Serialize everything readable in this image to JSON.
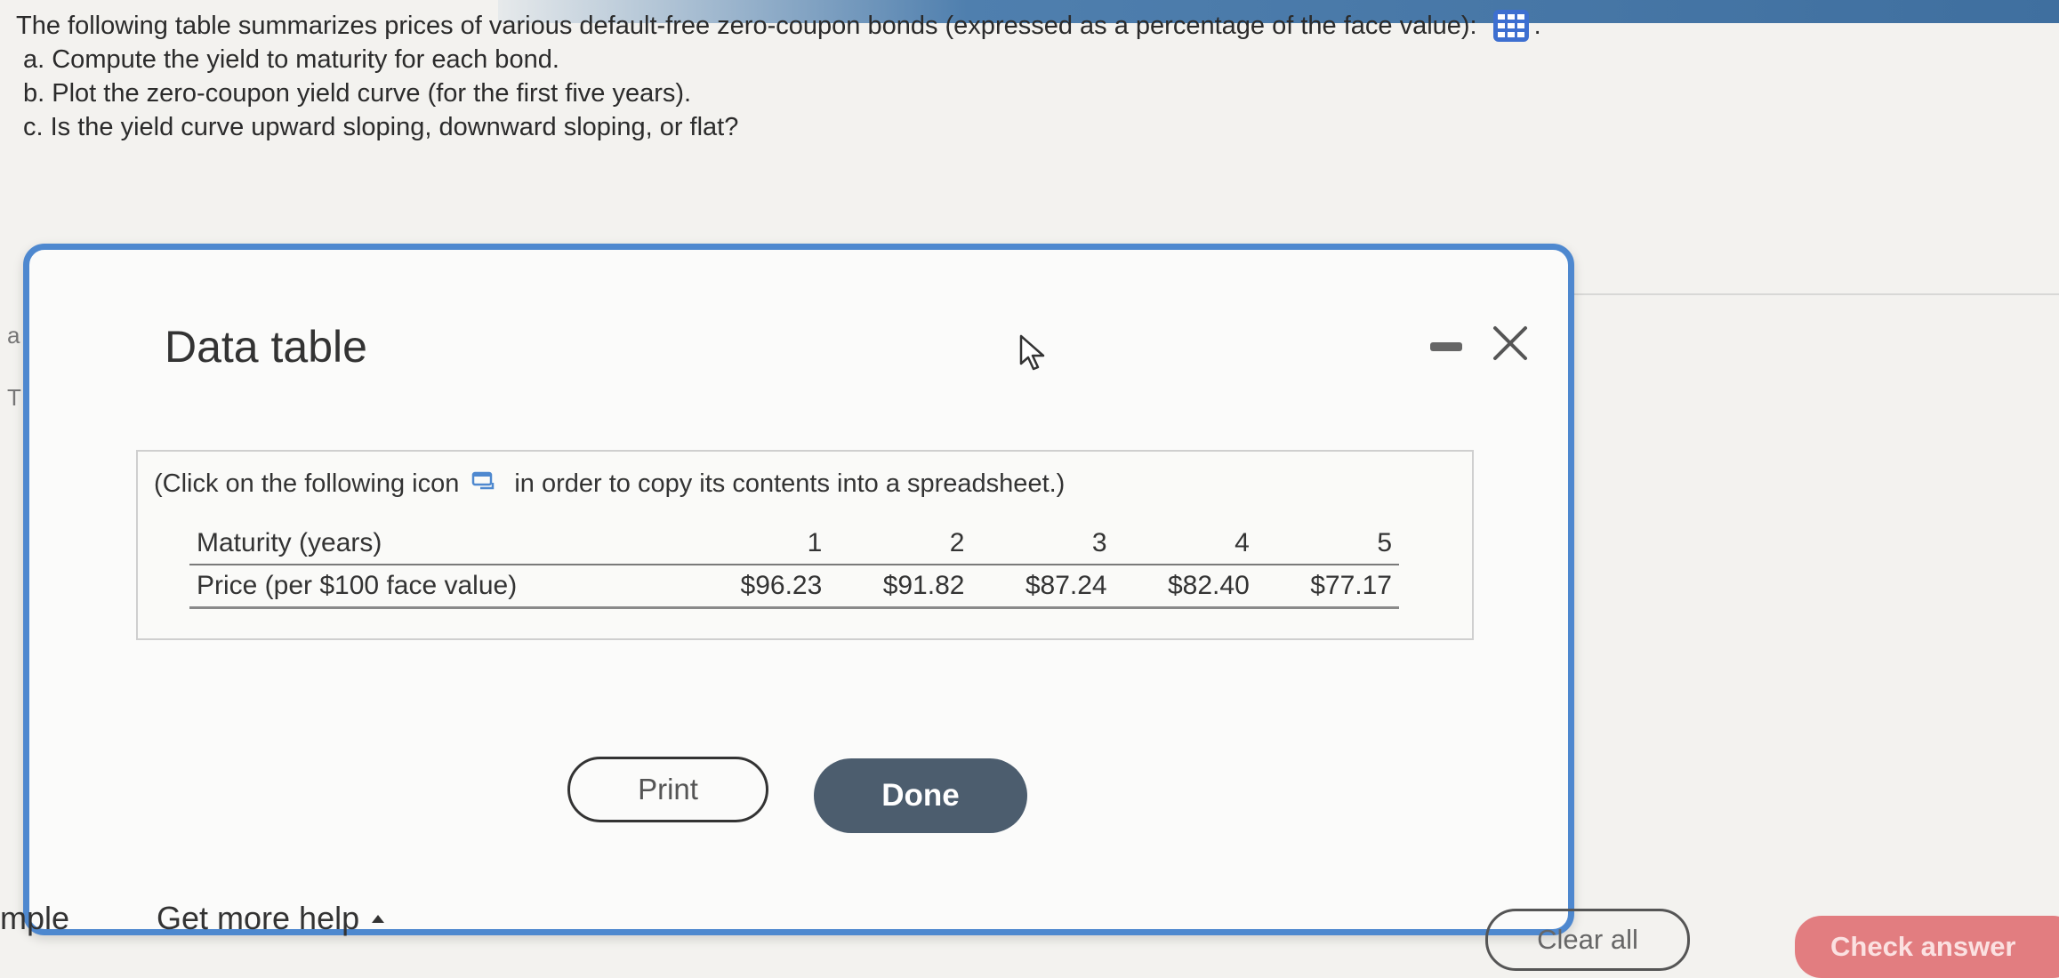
{
  "question": {
    "intro": "The following table summarizes prices of various default-free zero-coupon bonds (expressed as a percentage of the face value):",
    "part_a": "a. Compute the yield to maturity for each bond.",
    "part_b": "b. Plot the zero-coupon yield curve (for the first five years).",
    "part_c": "c. Is the yield curve upward sloping, downward sloping, or flat?"
  },
  "edge_letters": [
    "a",
    "T"
  ],
  "modal": {
    "title": "Data table",
    "instruction_before": "(Click on the following icon",
    "instruction_after": "in order to copy its contents into a spreadsheet.)",
    "table": {
      "header_label": "Maturity (years)",
      "maturities": [
        "1",
        "2",
        "3",
        "4",
        "5"
      ],
      "row_label": "Price (per $100 face value)",
      "prices": [
        "$96.23",
        "$91.82",
        "$87.24",
        "$82.40",
        "$77.17"
      ]
    },
    "print_label": "Print",
    "done_label": "Done"
  },
  "footer": {
    "example_label": "mple",
    "help_label": "Get more help",
    "clear_all_label": "Clear all",
    "check_answer_label": "Check answer"
  },
  "colors": {
    "modal_border": "#4e88cf",
    "done_button": "#4c5d6e",
    "check_answer_button": "#e27d80",
    "grid_icon": "#3d6fd0"
  },
  "icons": [
    "grid-icon",
    "copy-icon",
    "minimize-icon",
    "close-icon",
    "cursor-icon",
    "caret-up-icon"
  ]
}
